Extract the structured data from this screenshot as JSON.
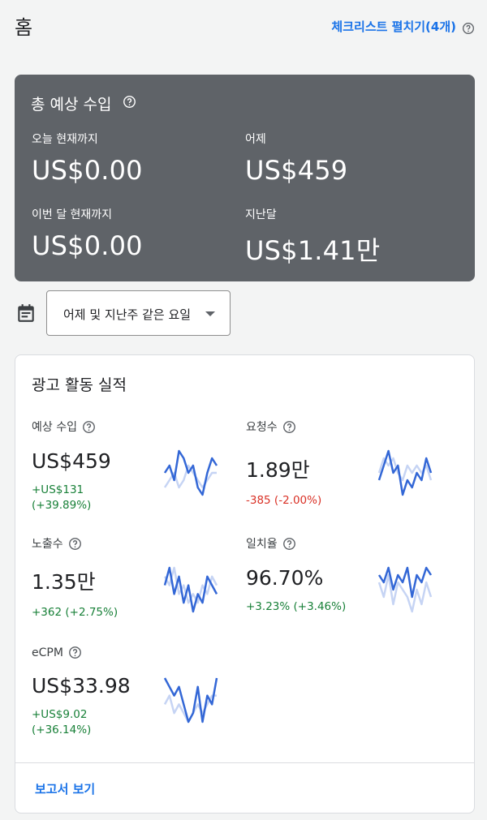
{
  "header": {
    "title": "홈",
    "checklist_link": "체크리스트 펼치기(4개)"
  },
  "earnings": {
    "title": "총 예상 수입",
    "today_label": "오늘 현재까지",
    "today_value": "US$0.00",
    "yesterday_label": "어제",
    "yesterday_value": "US$459",
    "month_label": "이번 달 현재까지",
    "month_value": "US$0.00",
    "last_month_label": "지난달",
    "last_month_value": "US$1.41만"
  },
  "date_filter": {
    "selected": "어제 및 지난주 같은 요일"
  },
  "performance": {
    "title": "광고 활동 실적",
    "metrics": [
      {
        "label": "예상 수입",
        "value": "US$459",
        "change_line1": "+US$131",
        "change_line2": "(+39.89%)",
        "trend": "up",
        "current": [
          5,
          6,
          4,
          8,
          7,
          5,
          6,
          3,
          2,
          5,
          7,
          6
        ],
        "previous": [
          3,
          4,
          5,
          3,
          4,
          6,
          5,
          4,
          3,
          4,
          5,
          5
        ]
      },
      {
        "label": "요청수",
        "value": "1.89만",
        "change_line1": "-385 (-2.00%)",
        "change_line2": "",
        "trend": "down",
        "current": [
          4,
          6,
          8,
          5,
          6,
          2,
          4,
          3,
          5,
          4,
          7,
          5
        ],
        "previous": [
          5,
          7,
          6,
          7,
          5,
          4,
          6,
          5,
          6,
          5,
          6,
          4
        ]
      },
      {
        "label": "노출수",
        "value": "1.35만",
        "change_line1": "+362 (+2.75%)",
        "change_line2": "",
        "trend": "up",
        "current": [
          5,
          7,
          4,
          6,
          3,
          5,
          2,
          4,
          3,
          6,
          5,
          4
        ],
        "previous": [
          6,
          5,
          7,
          4,
          5,
          3,
          4,
          3,
          5,
          4,
          6,
          5
        ]
      },
      {
        "label": "일치율",
        "value": "96.70%",
        "change_line1": "+3.23% (+3.46%)",
        "change_line2": "",
        "trend": "up",
        "current": [
          7,
          6,
          8,
          5,
          7,
          6,
          8,
          4,
          7,
          6,
          8,
          7
        ],
        "previous": [
          6,
          4,
          7,
          3,
          6,
          5,
          4,
          2,
          5,
          3,
          6,
          4
        ]
      },
      {
        "label": "eCPM",
        "value": "US$33.98",
        "change_line1": "+US$9.02",
        "change_line2": "(+36.14%)",
        "trend": "up",
        "current": [
          7,
          6,
          5,
          6,
          4,
          2,
          3,
          6,
          2,
          5,
          4,
          7
        ],
        "previous": [
          4,
          5,
          3,
          4,
          3,
          2,
          3,
          4,
          3,
          4,
          5,
          5
        ]
      }
    ],
    "report_link": "보고서 보기"
  },
  "colors": {
    "accent": "#1a73e8",
    "positive": "#188038",
    "negative": "#d93025",
    "card_dark": "#5f6368",
    "spark_current": "#3367d6",
    "spark_previous": "#c6d4f4"
  }
}
